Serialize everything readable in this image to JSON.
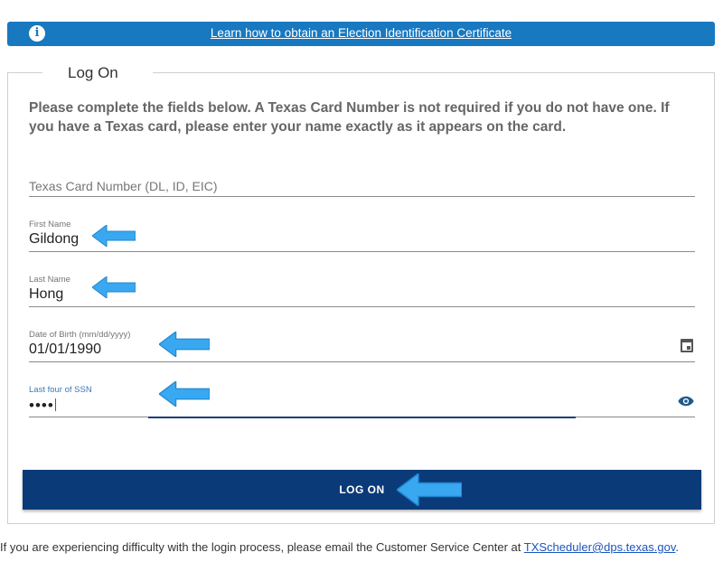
{
  "banner": {
    "icon": "info-icon",
    "icon_glyph": "i",
    "link_text": "Learn how to obtain an Election Identification Certificate",
    "color": "#1878c0"
  },
  "form": {
    "legend": "Log On",
    "instructions": "Please complete the fields below. A Texas Card Number is not required if you do not have one. If you have a Texas card, please enter your name exactly as it appears on the card.",
    "card_number": {
      "placeholder": "Texas Card Number (DL, ID, EIC)",
      "value": ""
    },
    "first_name": {
      "label": "First Name",
      "value": "Gildong"
    },
    "last_name": {
      "label": "Last Name",
      "value": "Hong"
    },
    "dob": {
      "label": "Date of Birth (mm/dd/yyyy)",
      "value": "01/01/1990",
      "icon": "calendar-icon"
    },
    "ssn": {
      "label": "Last four of SSN",
      "value": "••••",
      "icon": "eye-icon"
    },
    "submit_label": "LOG ON",
    "button_color": "#0b3a79"
  },
  "annotations": {
    "arrow_color": "#3aa8f0",
    "arrow_icon": "left-arrow-icon"
  },
  "footer": {
    "text": "If you are experiencing difficulty with the login process, please email the Customer Service Center at ",
    "email": "TXScheduler@dps.texas.gov",
    "suffix": "."
  }
}
